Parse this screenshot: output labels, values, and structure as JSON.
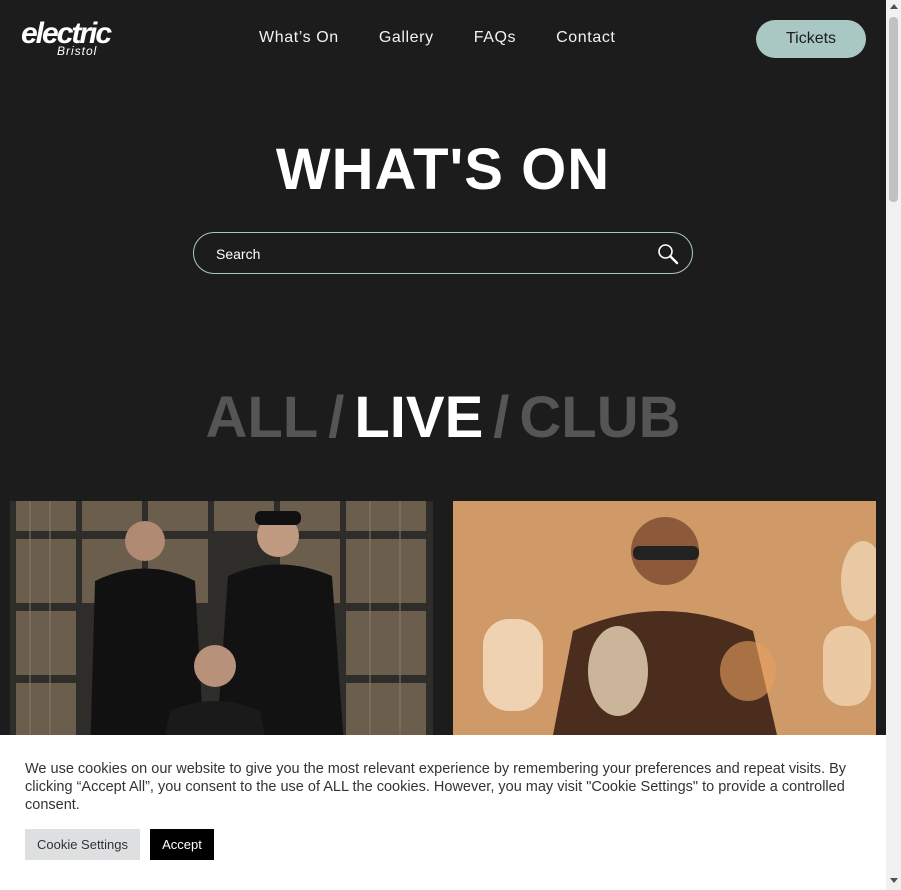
{
  "header": {
    "logo_main": "electric",
    "logo_sub": "Bristol",
    "nav": [
      "What’s On",
      "Gallery",
      "FAQs",
      "Contact"
    ],
    "tickets_label": "Tickets"
  },
  "hero": {
    "title": "WHAT'S ON",
    "search_placeholder": "Search",
    "icon": "search-icon"
  },
  "filters": {
    "all": "ALL",
    "live": "LIVE",
    "club": "CLUB",
    "separator": "/",
    "active": "LIVE"
  },
  "cookie": {
    "message": "We use cookies on our website to give you the most relevant experience by remembering your preferences and repeat visits. By clicking “Accept All”, you consent to the use of ALL the cookies. However, you may visit \"Cookie Settings\" to provide a controlled consent.",
    "settings_label": "Cookie Settings",
    "accept_label": "Accept"
  },
  "colors": {
    "background": "#1c1c1c",
    "accent": "#a9c8c4",
    "inactive_filter": "#555555"
  }
}
